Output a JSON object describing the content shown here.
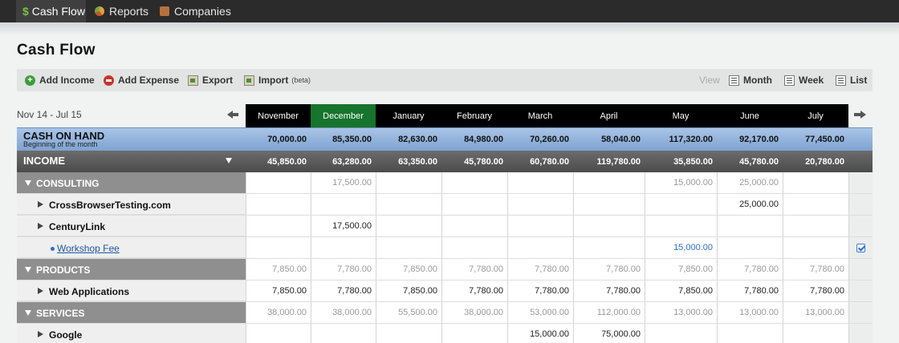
{
  "nav": [
    {
      "label": "Cash Flow",
      "icon": "dollar-icon"
    },
    {
      "label": "Reports",
      "icon": "pie-chart-icon"
    },
    {
      "label": "Companies",
      "icon": "briefcase-icon"
    }
  ],
  "page": {
    "title": "Cash Flow"
  },
  "toolbar": {
    "add_income": "Add Income",
    "add_expense": "Add Expense",
    "export": "Export",
    "import": "Import",
    "import_badge": "(beta)",
    "view_label": "View",
    "month": "Month",
    "week": "Week",
    "list": "List"
  },
  "range": "Nov 14 - Jul 15",
  "months": [
    "November",
    "December",
    "January",
    "February",
    "March",
    "April",
    "May",
    "June",
    "July"
  ],
  "cash_on_hand": {
    "title": "CASH ON HAND",
    "subtitle": "Beginning of the month",
    "values": [
      "70,000.00",
      "85,350.00",
      "82,630.00",
      "84,980.00",
      "70,260.00",
      "58,040.00",
      "117,320.00",
      "92,170.00",
      "77,450.00"
    ]
  },
  "income": {
    "title": "INCOME",
    "values": [
      "45,850.00",
      "63,280.00",
      "63,350.00",
      "45,780.00",
      "60,780.00",
      "119,780.00",
      "35,850.00",
      "45,780.00",
      "20,780.00"
    ]
  },
  "rows": [
    {
      "type": "cat",
      "label": "CONSULTING",
      "values": [
        "",
        "17,500.00",
        "",
        "",
        "",
        "",
        "15,000.00",
        "25,000.00",
        ""
      ]
    },
    {
      "type": "sub",
      "label": "CrossBrowserTesting.com",
      "values": [
        "",
        "",
        "",
        "",
        "",
        "",
        "",
        "25,000.00",
        ""
      ]
    },
    {
      "type": "sub",
      "label": "CenturyLink",
      "values": [
        "",
        "17,500.00",
        "",
        "",
        "",
        "",
        "",
        "",
        ""
      ]
    },
    {
      "type": "item",
      "label": "Workshop Fee",
      "values": [
        "",
        "",
        "",
        "",
        "",
        "",
        "15,000.00",
        "",
        ""
      ]
    },
    {
      "type": "cat",
      "label": "PRODUCTS",
      "values": [
        "7,850.00",
        "7,780.00",
        "7,850.00",
        "7,780.00",
        "7,780.00",
        "7,780.00",
        "7,850.00",
        "7,780.00",
        "7,780.00"
      ]
    },
    {
      "type": "sub",
      "label": "Web Applications",
      "values": [
        "7,850.00",
        "7,780.00",
        "7,850.00",
        "7,780.00",
        "7,780.00",
        "7,780.00",
        "7,850.00",
        "7,780.00",
        "7,780.00"
      ]
    },
    {
      "type": "cat",
      "label": "SERVICES",
      "values": [
        "38,000.00",
        "38,000.00",
        "55,500.00",
        "38,000.00",
        "53,000.00",
        "112,000.00",
        "13,000.00",
        "13,000.00",
        "13,000.00"
      ]
    },
    {
      "type": "sub",
      "label": "Google",
      "values": [
        "",
        "",
        "",
        "",
        "15,000.00",
        "75,000.00",
        "",
        "",
        ""
      ]
    }
  ]
}
